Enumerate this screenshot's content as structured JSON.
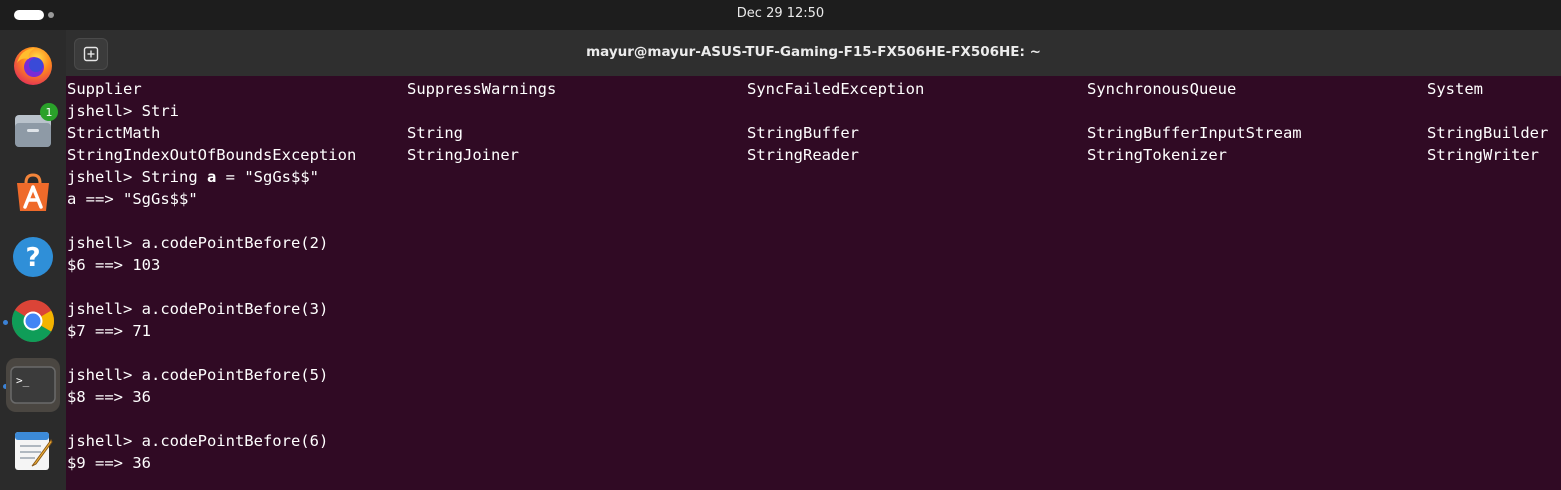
{
  "topbar": {
    "clock": "Dec 29  12:50"
  },
  "dock": {
    "items": [
      {
        "name": "Firefox",
        "icon": "firefox-icon"
      },
      {
        "name": "Files",
        "icon": "files-icon",
        "badge": "1"
      },
      {
        "name": "App Center",
        "icon": "app-center-icon"
      },
      {
        "name": "Help",
        "icon": "help-icon"
      },
      {
        "name": "Google Chrome",
        "icon": "chrome-icon"
      },
      {
        "name": "Terminal",
        "icon": "terminal-icon"
      },
      {
        "name": "Text Editor",
        "icon": "text-editor-icon"
      }
    ]
  },
  "window": {
    "title": "mayur@mayur-ASUS-TUF-Gaming-F15-FX506HE-FX506HE: ~"
  },
  "terminal": {
    "colors": {
      "background": "#300a24",
      "text": "#ffffff"
    },
    "completion_row1": [
      "Supplier",
      "SuppressWarnings",
      "SyncFailedException",
      "SynchronousQueue",
      "System"
    ],
    "prompt1": "jshell> Stri",
    "completion_row2": [
      "StrictMath",
      "String",
      "StringBuffer",
      "StringBufferInputStream",
      "StringBuilder"
    ],
    "completion_row3": [
      "StringIndexOutOfBoundsException",
      "StringJoiner",
      "StringReader",
      "StringTokenizer",
      "StringWriter"
    ],
    "prompt2_prefix": "jshell> String ",
    "prompt2_var": "a",
    "prompt2_suffix": " = \"SgGs$$\"",
    "output2": "a ==> \"SgGs$$\"",
    "cmd3": "jshell> a.codePointBefore(2)",
    "out3": "$6 ==> 103",
    "cmd4": "jshell> a.codePointBefore(3)",
    "out4": "$7 ==> 71",
    "cmd5": "jshell> a.codePointBefore(5)",
    "out5": "$8 ==> 36",
    "cmd6": "jshell> a.codePointBefore(6)",
    "out6": "$9 ==> 36"
  }
}
